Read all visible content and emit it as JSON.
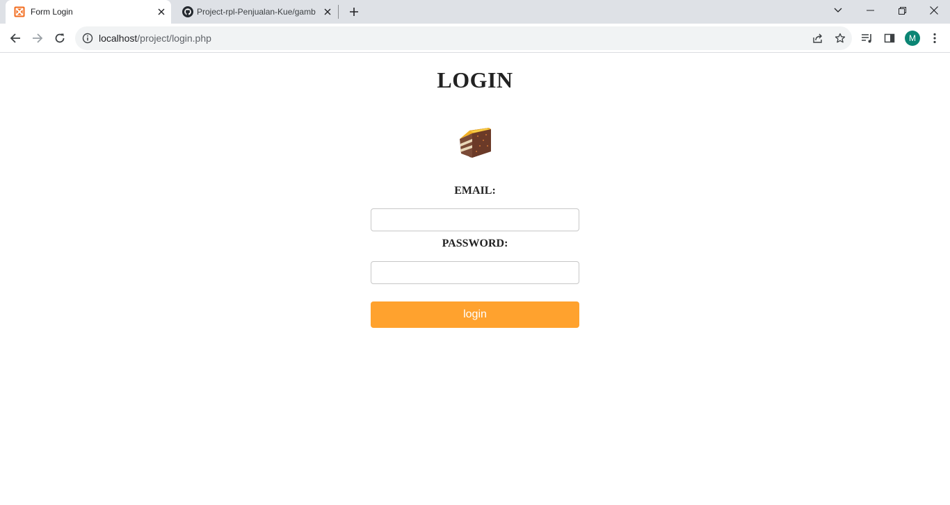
{
  "browser": {
    "tabs": [
      {
        "title": "Form Login",
        "active": true
      },
      {
        "title": "Project-rpl-Penjualan-Kue/gamb",
        "active": false
      }
    ],
    "url_host": "localhost",
    "url_path": "/project/login.php",
    "profile_initial": "M",
    "colors": {
      "tabstrip": "#dee1e6",
      "avatar": "#0b8574",
      "xampp_icon": "#f26b1d"
    }
  },
  "page": {
    "title": "LOGIN",
    "email_label": "EMAIL:",
    "email_value": "",
    "password_label": "PASSWORD:",
    "password_value": "",
    "login_label": "login",
    "colors": {
      "login_button": "#ffa22e",
      "text": "#222222"
    }
  }
}
